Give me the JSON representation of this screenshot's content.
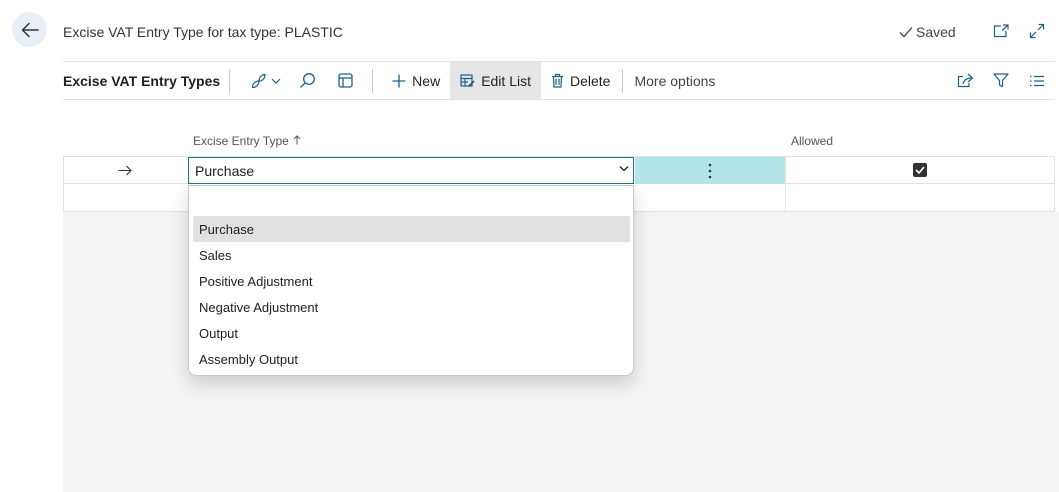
{
  "header": {
    "title": "Excise VAT Entry Type for tax type: PLASTIC",
    "saved_label": "Saved"
  },
  "toolbar": {
    "caption": "Excise VAT Entry Types",
    "new_label": "New",
    "edit_list_label": "Edit List",
    "delete_label": "Delete",
    "more_options_label": "More options"
  },
  "grid": {
    "columns": [
      {
        "label": "Excise Entry Type",
        "sort": "ascending"
      },
      {
        "label": "Allowed"
      }
    ],
    "rows": [
      {
        "entry_type": "Purchase",
        "allowed": true
      }
    ]
  },
  "dropdown": {
    "selected": "Purchase",
    "options": [
      "Purchase",
      "Sales",
      "Positive Adjustment",
      "Negative Adjustment",
      "Output",
      "Assembly Output"
    ]
  },
  "colors": {
    "accent_teal": "#1e7a83",
    "selected_cell": "#b4e5ea",
    "back_button_bg": "#e8eff5"
  },
  "icons": [
    "back-arrow-icon",
    "checkmark-icon",
    "open-new-window-icon",
    "expand-icon",
    "analysis-mode-icon",
    "chevron-down-icon",
    "search-icon",
    "personalize-icon",
    "plus-icon",
    "edit-list-icon",
    "trash-icon",
    "share-icon",
    "filter-icon",
    "list-view-icon",
    "row-arrow-icon",
    "more-dots-icon",
    "sort-up-icon"
  ]
}
